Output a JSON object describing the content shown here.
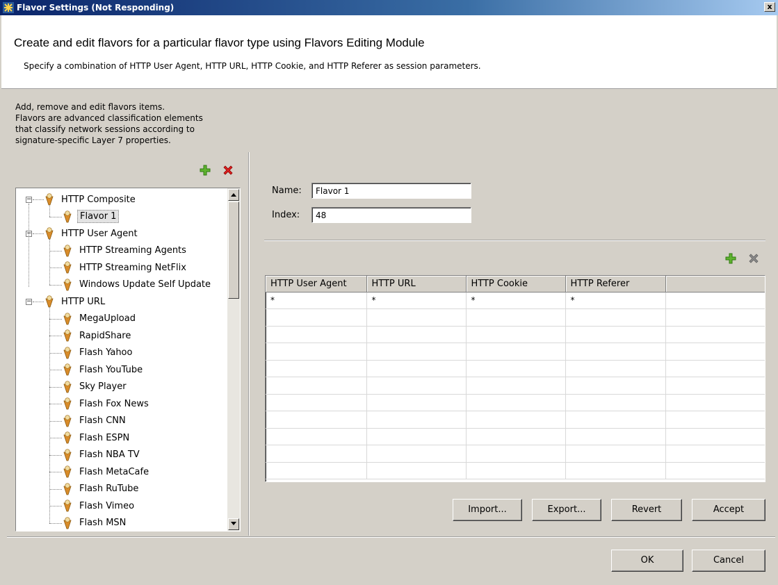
{
  "window": {
    "title": "Flavor Settings (Not Responding)",
    "close_label": "x"
  },
  "header": {
    "title": "Create and edit flavors for a particular flavor type using Flavors Editing Module",
    "subtitle": "Specify a combination of  HTTP User Agent, HTTP URL, HTTP Cookie, and HTTP Referer as session parameters."
  },
  "left_panel": {
    "description": [
      "Add, remove and edit flavors items.",
      "Flavors are advanced classification elements",
      "that classify network sessions according to",
      "signature-specific Layer 7 properties."
    ],
    "tree": [
      {
        "label": "HTTP Composite",
        "expanded": true,
        "children": [
          {
            "label": "Flavor 1",
            "selected": true
          }
        ]
      },
      {
        "label": "HTTP User Agent",
        "expanded": true,
        "children": [
          {
            "label": "HTTP Streaming Agents"
          },
          {
            "label": "HTTP Streaming NetFlix"
          },
          {
            "label": "Windows Update Self Update"
          }
        ]
      },
      {
        "label": "HTTP URL",
        "expanded": true,
        "children": [
          {
            "label": "MegaUpload"
          },
          {
            "label": "RapidShare"
          },
          {
            "label": "Flash Yahoo"
          },
          {
            "label": "Flash YouTube"
          },
          {
            "label": "Sky Player"
          },
          {
            "label": "Flash Fox News"
          },
          {
            "label": "Flash CNN"
          },
          {
            "label": "Flash ESPN"
          },
          {
            "label": "Flash NBA TV"
          },
          {
            "label": "Flash MetaCafe"
          },
          {
            "label": "Flash RuTube"
          },
          {
            "label": "Flash Vimeo"
          },
          {
            "label": "Flash MSN"
          }
        ]
      }
    ]
  },
  "form": {
    "name_label": "Name:",
    "name_value": "Flavor 1",
    "index_label": "Index:",
    "index_value": "48"
  },
  "table": {
    "columns": [
      "HTTP User Agent",
      "HTTP URL",
      "HTTP Cookie",
      "HTTP Referer",
      ""
    ],
    "rows": [
      [
        "*",
        "*",
        "*",
        "*",
        ""
      ]
    ]
  },
  "buttons": {
    "import": "Import...",
    "export": "Export...",
    "revert": "Revert",
    "accept": "Accept",
    "ok": "OK",
    "cancel": "Cancel"
  },
  "colors": {
    "add_icon": "#5fb32f",
    "delete_icon": "#e02020",
    "delete_icon_disabled": "#8a8a8a",
    "flavor_icon": "#d98c2a"
  }
}
